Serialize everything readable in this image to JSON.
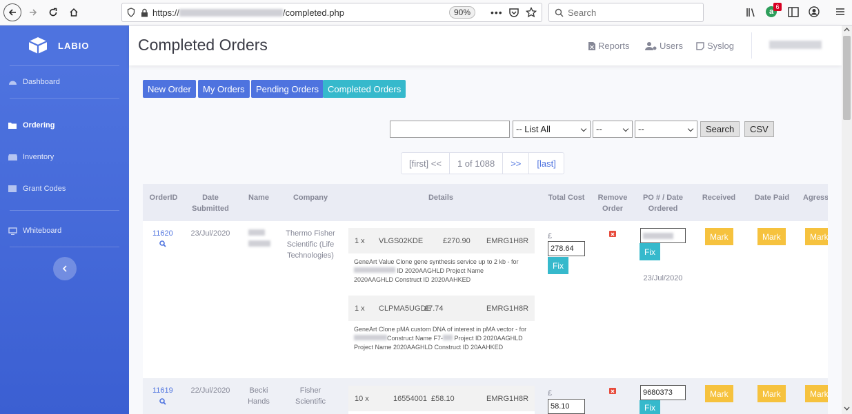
{
  "browser": {
    "url_prefix": "https://",
    "url_suffix": "/completed.php",
    "zoom": "90%",
    "search_placeholder": "Search",
    "notif_count": "6"
  },
  "brand": {
    "name": "LABIO"
  },
  "sidebar": {
    "items": [
      {
        "label": "Dashboard"
      },
      {
        "label": "Ordering"
      },
      {
        "label": "Inventory"
      },
      {
        "label": "Grant Codes"
      },
      {
        "label": "Whiteboard"
      }
    ]
  },
  "topbar": {
    "title": "Completed Orders",
    "links": [
      "Reports",
      "Users",
      "Syslog"
    ]
  },
  "tabs": [
    "New Order",
    "My Orders",
    "Pending Orders",
    "Completed Orders"
  ],
  "filters": {
    "list_value": "-- List All",
    "select2_value": "--",
    "select3_value": "--",
    "search_label": "Search",
    "csv_label": "CSV"
  },
  "pager": {
    "first": "[first] <<",
    "status": "1 of 1088",
    "next": ">>",
    "last": "[last]"
  },
  "columns": [
    "OrderID",
    "Date Submitted",
    "Name",
    "Company",
    "Details",
    "Total Cost",
    "Remove Order",
    "PO # / Date Ordered",
    "Received",
    "Date Paid",
    "Agress"
  ],
  "orders": [
    {
      "id": "11620",
      "date": "23/Jul/2020",
      "company": "Thermo Fisher Scientific (Life Technologies)",
      "items": [
        {
          "qty": "1 x",
          "code": "VLGS02KDE",
          "price": "£270.90",
          "grant": "EMRG1H8R",
          "desc1": "GeneArt Value Clone gene synthesis service up to 2 kb - for",
          "desc2": "ID 2020AAGHLD Project Name",
          "desc3": "2020AAGHLD Construct ID 2020AAHKED"
        },
        {
          "qty": "1 x",
          "code": "CLPMA5UGDE",
          "price": "£7.74",
          "grant": "EMRG1H8R",
          "desc1": "GeneArt Clone pMA custom DNA of interest in pMA vector - for",
          "desc2": "Construct Name F7-",
          "desc2b": "Project ID 2020AAGHLD",
          "desc3": "Project Name 2020AAGHLD Construct ID 20AAHKED"
        }
      ],
      "currency": "£",
      "total": "278.64",
      "fix_label": "Fix",
      "po": "",
      "ordered": "23/Jul/2020",
      "mark_label": "Mark"
    },
    {
      "id": "11619",
      "date": "22/Jul/2020",
      "name": "Becki Hands",
      "company": "Fisher Scientific",
      "items": [
        {
          "qty": "10 x",
          "code": "16554001",
          "price": "£58.10",
          "grant": "EMRG1H8R"
        }
      ],
      "currency": "£",
      "total": "58.10",
      "fix_label": "Fix",
      "po": "9680373",
      "mark_label": "Mark"
    }
  ],
  "colors": {
    "primary": "#4e73df",
    "info": "#36b9cc",
    "warning": "#f6c23e",
    "danger": "#e74a3b"
  }
}
